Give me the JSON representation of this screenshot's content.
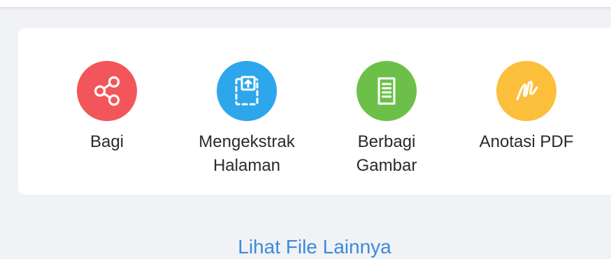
{
  "actions": [
    {
      "label": "Bagi",
      "icon": "share-icon",
      "color": "#f2565a"
    },
    {
      "label": "Mengekstrak\nHalaman",
      "icon": "extract-page-icon",
      "color": "#2ea6ec"
    },
    {
      "label": "Berbagi\nGambar",
      "icon": "share-image-icon",
      "color": "#6cc04a"
    },
    {
      "label": "Anotasi PDF",
      "icon": "annotate-pen-icon",
      "color": "#fbbf3c"
    }
  ],
  "footer": {
    "more_files_label": "Lihat File Lainnya"
  }
}
